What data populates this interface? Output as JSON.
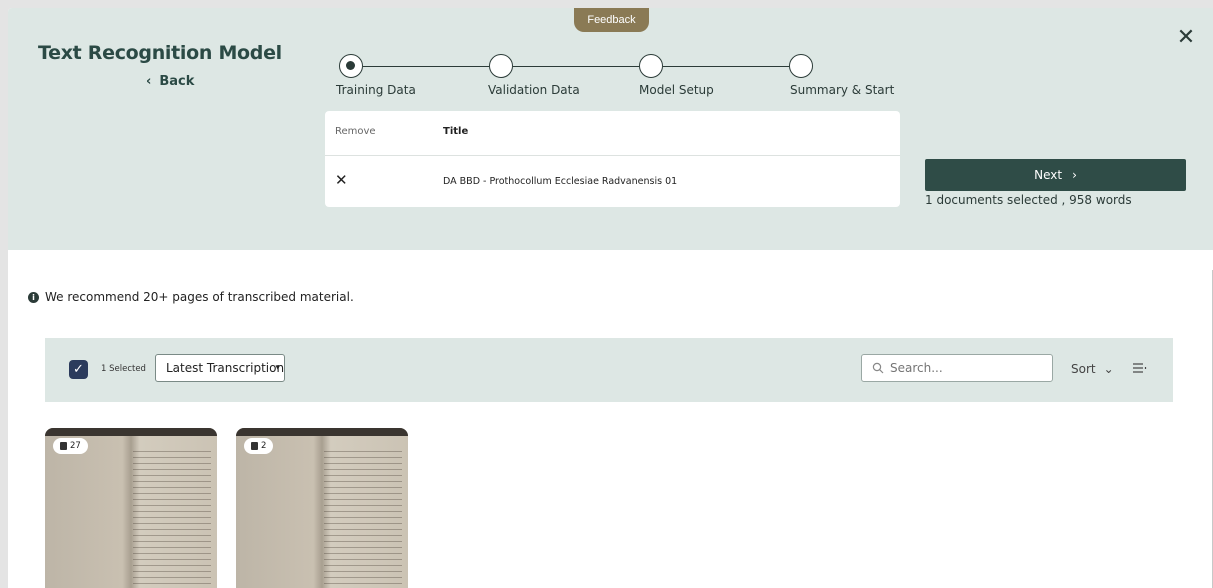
{
  "feedback_label": "Feedback",
  "header": {
    "title": "Text Recognition Model",
    "back_label": "Back",
    "close_glyph": "✕"
  },
  "stepper": {
    "steps": [
      {
        "label": "Training Data",
        "active": true
      },
      {
        "label": "Validation Data",
        "active": false
      },
      {
        "label": "Model Setup",
        "active": false
      },
      {
        "label": "Summary & Start",
        "active": false
      }
    ]
  },
  "documents_table": {
    "columns": {
      "remove": "Remove",
      "title": "Title"
    },
    "rows": [
      {
        "remove_glyph": "✕",
        "title": "DA BBD - Prothocollum Ecclesiae Radvanensis 01"
      }
    ]
  },
  "next_button": {
    "label": "Next",
    "chevron": "›"
  },
  "selection_info": "1 documents selected , 958 words",
  "recommendation": "We recommend 20+ pages of transcribed material.",
  "toolbar": {
    "checkbox_checked": true,
    "selected_count": "1 Selected",
    "transcription_select": "Latest Transcription",
    "search_placeholder": "Search...",
    "sort_label": "Sort"
  },
  "cards": [
    {
      "page_count": "27"
    },
    {
      "page_count": "2"
    }
  ],
  "colors": {
    "header_bg": "#dde7e4",
    "primary": "#2f4c47",
    "feedback": "#8a7a55",
    "checkbox": "#2b3b5c"
  }
}
